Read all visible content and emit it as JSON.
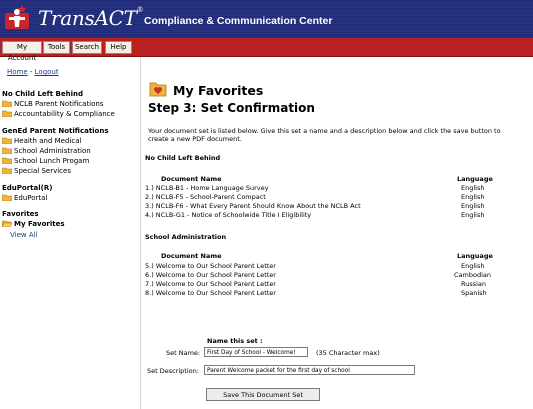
{
  "header": {
    "brand": "TransACT",
    "trademark": "®",
    "subtitle": "Compliance & Communication Center"
  },
  "menubar": {
    "items": [
      "My Account",
      "Tools",
      "Search",
      "Help"
    ]
  },
  "sidebar": {
    "home": "Home",
    "sep": " - ",
    "logout": "Logout",
    "sections": [
      {
        "title": "No Child Left Behind",
        "items": [
          "NCLB Parent Notifications",
          "Accountability & Compliance"
        ]
      },
      {
        "title": "GenEd Parent Notifications",
        "items": [
          "Health and Medical",
          "School Administration",
          "School Lunch Progam",
          "Special Services"
        ]
      },
      {
        "title": "EduPortal(R)",
        "items": [
          "EduPortal"
        ]
      },
      {
        "title": "Favorites",
        "items": [
          "My Favorites"
        ]
      }
    ],
    "view_all": "View All"
  },
  "main": {
    "page_title": "My Favorites",
    "step_title": "Step 3: Set Confirmation",
    "intro_line1": "Your document set is listed below. Give this set a name and a description below and click the save button to",
    "intro_line2": "create a new PDF document.",
    "col_document": "Document Name",
    "col_language": "Language",
    "groups": [
      {
        "title": "No Child Left Behind",
        "rows": [
          {
            "name": "1.) NCLB-B1 - Home Language Survey",
            "lang": "English"
          },
          {
            "name": "2.) NCLB-F5 - School-Parent Compact",
            "lang": "English"
          },
          {
            "name": "3.) NCLB-F6 - What Every Parent Should Know About the NCLB Act",
            "lang": "English"
          },
          {
            "name": "4.) NCLB-G1 - Notice of Schoolwide Title I Eligibility",
            "lang": "English"
          }
        ]
      },
      {
        "title": "School Administration",
        "rows": [
          {
            "name": "5.) Welcome to Our School Parent Letter",
            "lang": "English"
          },
          {
            "name": "6.) Welcome to Our School Parent Letter",
            "lang": "Cambodian"
          },
          {
            "name": "7.) Welcome to Our School Parent Letter",
            "lang": "Russian"
          },
          {
            "name": "8.) Welcome to Our School Parent Letter",
            "lang": "Spanish"
          }
        ]
      }
    ],
    "form": {
      "heading": "Name this set :",
      "name_label": "Set Name:",
      "name_value": "First Day of School - Welcome!",
      "name_hint": "(35 Character max)",
      "desc_label": "Set Description:",
      "desc_value": "Parent Welcome packet for the first day of school",
      "save_label": "Save This Document Set"
    }
  },
  "colors": {
    "header_bg": "#1f2a78",
    "menubar_bg": "#b92020",
    "link": "#1f3c8c",
    "folder": "#f0b43c"
  }
}
